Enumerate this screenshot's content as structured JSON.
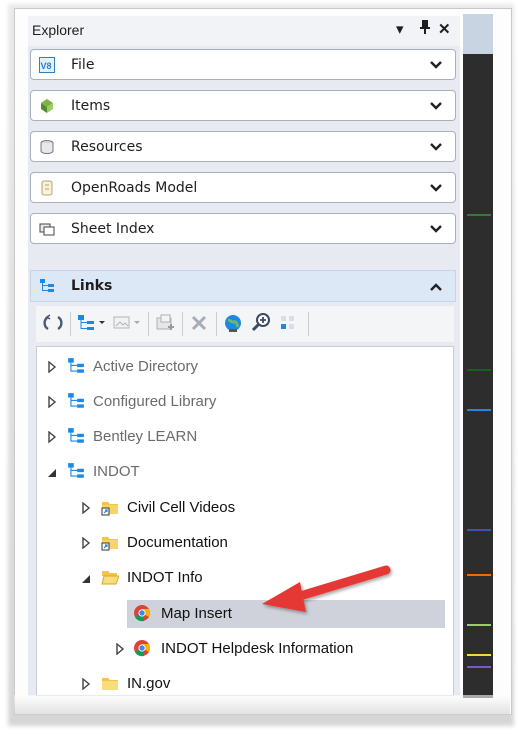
{
  "explorer": {
    "title": "Explorer",
    "controls": {
      "dropdown": "▾",
      "pin": "Ꮽ",
      "close": "✕"
    }
  },
  "sections": [
    {
      "label": "File",
      "icon": "v8-file-icon"
    },
    {
      "label": "Items",
      "icon": "items-icon"
    },
    {
      "label": "Resources",
      "icon": "resources-icon"
    },
    {
      "label": "OpenRoads Model",
      "icon": "openroads-model-icon"
    },
    {
      "label": "Sheet Index",
      "icon": "sheet-index-icon"
    }
  ],
  "links": {
    "label": "Links",
    "expanded": true,
    "toolbar": [
      "refresh-icon",
      "add-link-icon",
      "image-link-icon",
      "insert-icon",
      "delete-icon",
      "globe-icon",
      "zoom-icon",
      "grid-icon"
    ]
  },
  "tree": [
    {
      "label": "Active Directory",
      "state": "collapsed",
      "icon": "link-tree-icon",
      "style": "gray"
    },
    {
      "label": "Configured Library",
      "state": "collapsed",
      "icon": "link-tree-icon",
      "style": "gray"
    },
    {
      "label": "Bentley LEARN",
      "state": "collapsed",
      "icon": "link-tree-icon",
      "style": "gray"
    },
    {
      "label": "INDOT",
      "state": "expanded",
      "icon": "link-tree-icon",
      "style": "gray"
    },
    {
      "label": "Civil Cell Videos",
      "state": "collapsed",
      "icon": "folder-shortcut-icon",
      "style": "dark"
    },
    {
      "label": "Documentation",
      "state": "collapsed",
      "icon": "folder-shortcut-icon",
      "style": "dark"
    },
    {
      "label": "INDOT Info",
      "state": "expanded",
      "icon": "folder-open-icon",
      "style": "dark"
    },
    {
      "label": "Map Insert",
      "state": "leaf",
      "icon": "chrome-icon",
      "style": "dark",
      "selected": true
    },
    {
      "label": "INDOT Helpdesk Information",
      "state": "collapsed",
      "icon": "chrome-icon",
      "style": "dark"
    },
    {
      "label": "IN.gov",
      "state": "collapsed",
      "icon": "folder-icon",
      "style": "dark"
    }
  ],
  "colors": {
    "accent_arrow": "#e53935",
    "selected_row": "#cfd2da",
    "links_header": "#dde8f6"
  }
}
